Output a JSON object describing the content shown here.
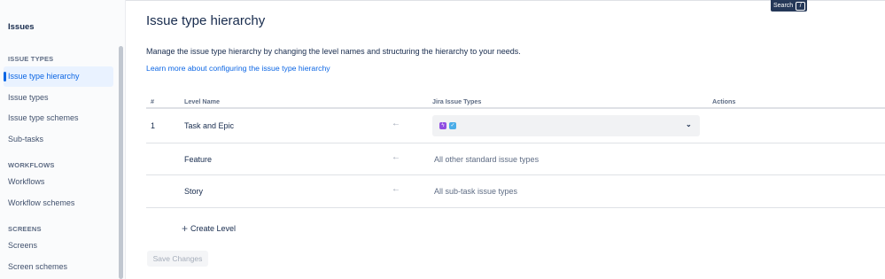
{
  "sidebar": {
    "title": "Issues",
    "sections": [
      {
        "label": "ISSUE TYPES",
        "items": [
          "Issue type hierarchy",
          "Issue types",
          "Issue type schemes",
          "Sub-tasks"
        ]
      },
      {
        "label": "WORKFLOWS",
        "items": [
          "Workflows",
          "Workflow schemes"
        ]
      },
      {
        "label": "SCREENS",
        "items": [
          "Screens",
          "Screen schemes"
        ]
      }
    ],
    "active_item": "Issue type hierarchy"
  },
  "search": {
    "label": "Search",
    "shortcut": "/"
  },
  "main": {
    "title": "Issue type hierarchy",
    "description": "Manage the issue type hierarchy by changing the level names and structuring the hierarchy to your needs.",
    "learn_more": "Learn more about configuring the issue type hierarchy",
    "table": {
      "headers": {
        "num": "#",
        "level_name": "Level Name",
        "issue_types": "Jira Issue Types",
        "actions": "Actions"
      },
      "rows": [
        {
          "num": "1",
          "level_name": "Task and Epic",
          "arrow": "←",
          "issue_types": ""
        },
        {
          "num": "",
          "level_name": "Feature",
          "arrow": "←",
          "issue_types": "All other standard issue types"
        },
        {
          "num": "",
          "level_name": "Story",
          "arrow": "←",
          "issue_types": "All sub-task issue types"
        }
      ],
      "select_chips": [
        "epic-icon",
        "task-icon"
      ]
    },
    "create_level": "Create Level",
    "save_changes": "Save Changes"
  },
  "colors": {
    "accent": "#0c66e4",
    "epic": "#904ee2",
    "task": "#4bade8"
  }
}
